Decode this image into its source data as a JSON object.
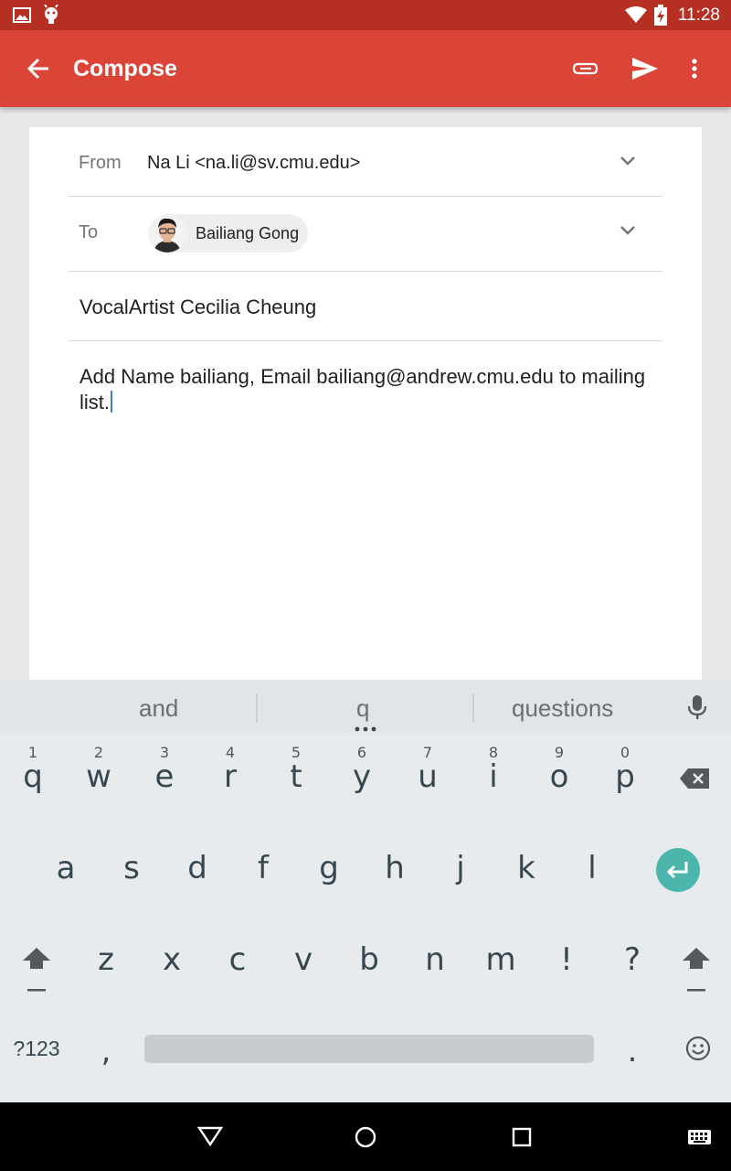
{
  "status_bar": {
    "time": "11:28"
  },
  "app_bar": {
    "title": "Compose"
  },
  "compose": {
    "from_label": "From",
    "from_value": "Na Li <na.li@sv.cmu.edu>",
    "to_label": "To",
    "to_recipient": "Bailiang Gong",
    "subject": "VocalArtist Cecilia Cheung",
    "body": "Add Name bailiang, Email bailiang@andrew.cmu.edu to mailing list."
  },
  "keyboard": {
    "suggestions": [
      "and",
      "q",
      "questions"
    ],
    "row1": [
      {
        "k": "q",
        "h": "1"
      },
      {
        "k": "w",
        "h": "2"
      },
      {
        "k": "e",
        "h": "3"
      },
      {
        "k": "r",
        "h": "4"
      },
      {
        "k": "t",
        "h": "5"
      },
      {
        "k": "y",
        "h": "6"
      },
      {
        "k": "u",
        "h": "7"
      },
      {
        "k": "i",
        "h": "8"
      },
      {
        "k": "o",
        "h": "9"
      },
      {
        "k": "p",
        "h": "0"
      }
    ],
    "row2": [
      "a",
      "s",
      "d",
      "f",
      "g",
      "h",
      "j",
      "k",
      "l"
    ],
    "row3": [
      "z",
      "x",
      "c",
      "v",
      "b",
      "n",
      "m",
      "!",
      "?"
    ],
    "symbols_label": "?123",
    "comma": ",",
    "period": ".",
    "accent_color": "#4db6ac"
  }
}
